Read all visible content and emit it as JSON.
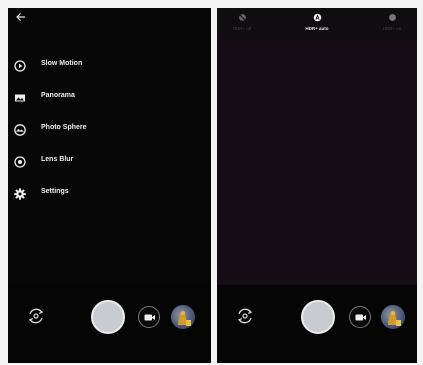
{
  "left": {
    "back_icon": "arrow-left-icon",
    "menu": [
      {
        "label": "Slow Motion",
        "icon": "slow-motion-icon"
      },
      {
        "label": "Panorama",
        "icon": "panorama-icon"
      },
      {
        "label": "Photo Sphere",
        "icon": "photo-sphere-icon"
      },
      {
        "label": "Lens Blur",
        "icon": "lens-blur-icon"
      },
      {
        "label": "Settings",
        "icon": "gear-icon"
      }
    ]
  },
  "right": {
    "hdr_options": [
      {
        "label": "HDR+ off",
        "icon": "hdr-off-icon",
        "active": false
      },
      {
        "label": "HDR+ auto",
        "icon": "hdr-auto-icon",
        "active": true
      },
      {
        "label": "HDR+ on",
        "icon": "hdr-on-icon",
        "active": false
      }
    ]
  },
  "controls": {
    "switch_camera_icon": "switch-camera-icon",
    "shutter_icon": "shutter-button",
    "mode_icon": "video-camera-icon",
    "thumbnail_icon": "gallery-thumbnail"
  },
  "colors": {
    "background": "#050505",
    "shutter": "#c8ccd0",
    "text": "#efefef"
  }
}
